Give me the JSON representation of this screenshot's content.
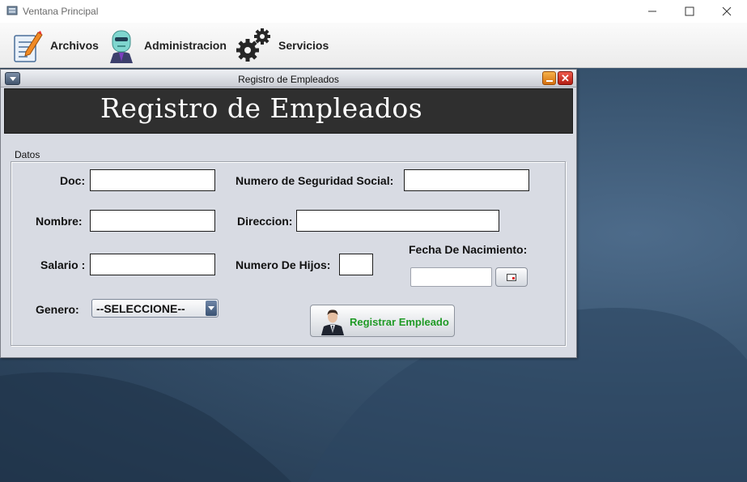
{
  "window": {
    "title": "Ventana Principal",
    "icon": "app-window-icon",
    "controls": [
      "minimize-icon",
      "maximize-icon",
      "close-icon"
    ]
  },
  "menubar": {
    "items": [
      {
        "label": "Archivos",
        "icon": "edit-document-icon"
      },
      {
        "label": "Administracion",
        "icon": "robot-admin-icon"
      },
      {
        "label": "Servicios",
        "icon": "gears-icon"
      }
    ]
  },
  "internal_frame": {
    "title": "Registro de Empleados",
    "header": "Registro de Empleados",
    "panel_title": "Datos",
    "fields": {
      "doc": {
        "label": "Doc:",
        "value": ""
      },
      "nss": {
        "label": "Numero de Seguridad Social:",
        "value": ""
      },
      "nombre": {
        "label": "Nombre:",
        "value": ""
      },
      "direccion": {
        "label": "Direccion:",
        "value": ""
      },
      "salario": {
        "label": "Salario :",
        "value": ""
      },
      "hijos": {
        "label": "Numero De Hijos:",
        "value": ""
      },
      "fecha": {
        "label": "Fecha De Nacimiento:",
        "value": ""
      },
      "genero": {
        "label": "Genero:",
        "selected": "--SELECCIONE--"
      }
    },
    "register_button": {
      "label": "Registrar Empleado",
      "icon": "businessman-icon"
    },
    "colors": {
      "header_bg": "#2f2f2f",
      "button_text": "#1f9a25",
      "frame_bg": "#d8dbe3"
    }
  }
}
